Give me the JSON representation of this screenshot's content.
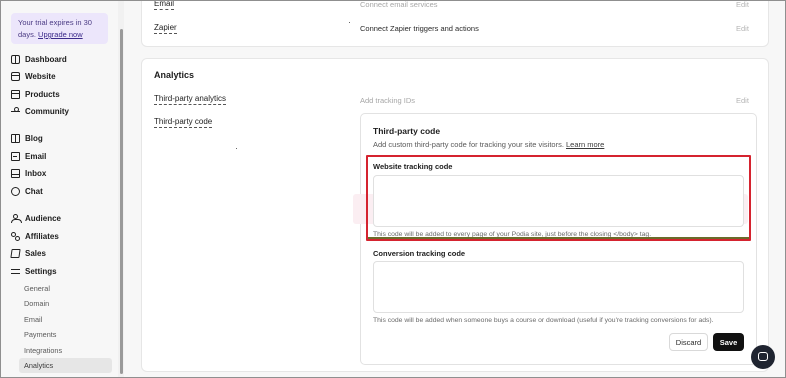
{
  "sidebar": {
    "trial_text": "Your trial expires in 30 days.",
    "upgrade_link": "Upgrade now",
    "nav_groups": [
      [
        {
          "label": "Dashboard",
          "icon": "dashboard-icon"
        },
        {
          "label": "Website",
          "icon": "website-icon"
        },
        {
          "label": "Products",
          "icon": "products-icon"
        },
        {
          "label": "Community",
          "icon": "community-icon"
        }
      ],
      [
        {
          "label": "Blog",
          "icon": "blog-icon"
        },
        {
          "label": "Email",
          "icon": "email-icon"
        },
        {
          "label": "Inbox",
          "icon": "inbox-icon"
        },
        {
          "label": "Chat",
          "icon": "chat-icon"
        }
      ],
      [
        {
          "label": "Audience",
          "icon": "audience-icon"
        },
        {
          "label": "Affiliates",
          "icon": "affiliates-icon"
        },
        {
          "label": "Sales",
          "icon": "sales-icon"
        },
        {
          "label": "Settings",
          "icon": "settings-icon"
        }
      ]
    ],
    "settings_sub": [
      "General",
      "Domain",
      "Email",
      "Payments",
      "Integrations",
      "Analytics"
    ],
    "active_sub": "Analytics"
  },
  "integrations_card": {
    "rows": [
      {
        "label": "Email",
        "description": "Connect email services",
        "edit": "Edit"
      },
      {
        "label": "Zapier",
        "description": "Connect Zapier triggers and actions",
        "edit": "Edit"
      }
    ]
  },
  "analytics_card": {
    "title": "Analytics",
    "third_party_analytics": {
      "label": "Third-party analytics",
      "description": "Add tracking IDs",
      "edit": "Edit"
    },
    "third_party_code": {
      "label": "Third-party code",
      "panel": {
        "title": "Third-party code",
        "description": "Add custom third-party code for tracking your site visitors.",
        "learn_more": "Learn more",
        "website_tracking": {
          "label": "Website tracking code",
          "value": "",
          "hint": "This code will be added to every page of your Podia site, just before the closing </body> tag."
        },
        "conversion_tracking": {
          "label": "Conversion tracking code",
          "value": "",
          "hint": "This code will be added when someone buys a course or download (useful if you're tracking conversions for ads)."
        },
        "discard_label": "Discard",
        "save_label": "Save"
      }
    }
  },
  "colors": {
    "highlight": "#d5232f",
    "trial_bg": "#ece6fb",
    "save_bg": "#111111"
  }
}
